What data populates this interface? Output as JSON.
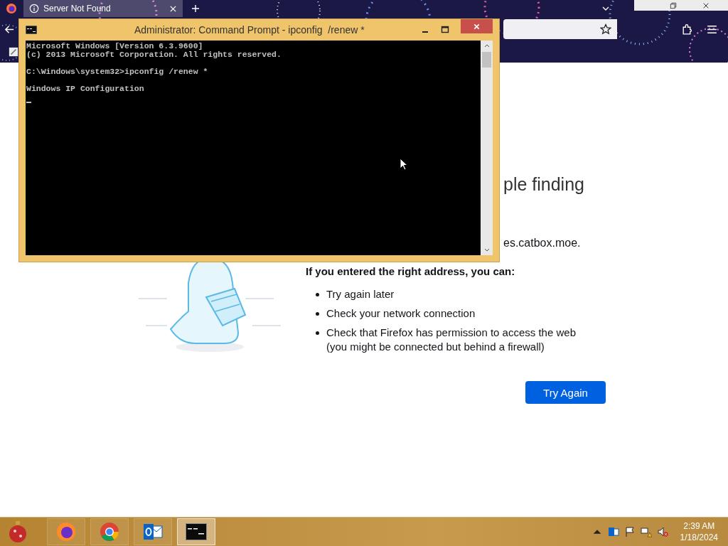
{
  "browser": {
    "tabs": [
      {
        "title": "Server Not Found",
        "selected": true
      }
    ]
  },
  "page": {
    "heading": "ple finding",
    "address_line": "es.catbox.moe.",
    "suggestion_intro": "If you entered the right address, you can:",
    "suggestions": [
      "Try again later",
      "Check your network connection",
      "Check that Firefox has permission to access the web (you might be connected but behind a firewall)"
    ],
    "button": "Try Again"
  },
  "console_window": {
    "title": "Administrator: Command Prompt - ipconfig  /renew *",
    "blocks": [
      [
        "Microsoft Windows [Version 6.3.9600]",
        "(c) 2013 Microsoft Corporation. All rights reserved."
      ],
      [
        "C:\\Windows\\system32>ipconfig /renew *"
      ],
      [
        "Windows IP Configuration"
      ]
    ]
  },
  "taskbar": {
    "apps": [
      {
        "kind": "firefox",
        "selected": false
      },
      {
        "kind": "chrome",
        "selected": false
      },
      {
        "kind": "outlook",
        "selected": false
      },
      {
        "kind": "console",
        "selected": true
      }
    ],
    "clock": {
      "time": "2:39 AM",
      "date": "1/18/2024"
    }
  }
}
